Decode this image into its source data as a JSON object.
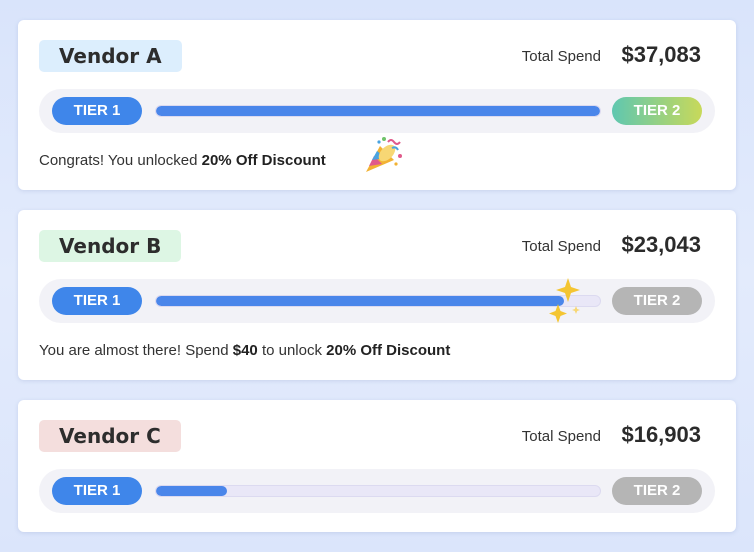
{
  "vendors": [
    {
      "name": "Vendor A",
      "tag_color": "#dceefd",
      "spend_label": "Total Spend",
      "spend_value": "$37,083",
      "tier1_label": "TIER 1",
      "tier2_label": "TIER 2",
      "progress": 1.0,
      "tier2_unlocked": true,
      "message_parts": [
        "Congrats! You unlocked ",
        "20% Off Discount"
      ],
      "icon": "party-popper-icon"
    },
    {
      "name": "Vendor B",
      "tag_color": "#ddf6e4",
      "spend_label": "Total Spend",
      "spend_value": "$23,043",
      "tier1_label": "TIER 1",
      "tier2_label": "TIER 2",
      "progress": 0.92,
      "tier2_unlocked": false,
      "message_parts": [
        "You are almost there! Spend ",
        "$40",
        " to unlock ",
        "20% Off Discount"
      ],
      "icon": "sparkles-icon"
    },
    {
      "name": "Vendor C",
      "tag_color": "#f4dedd",
      "spend_label": "Total Spend",
      "spend_value": "$16,903",
      "tier1_label": "TIER 1",
      "tier2_label": "TIER 2",
      "progress": 0.16,
      "tier2_unlocked": false
    }
  ]
}
